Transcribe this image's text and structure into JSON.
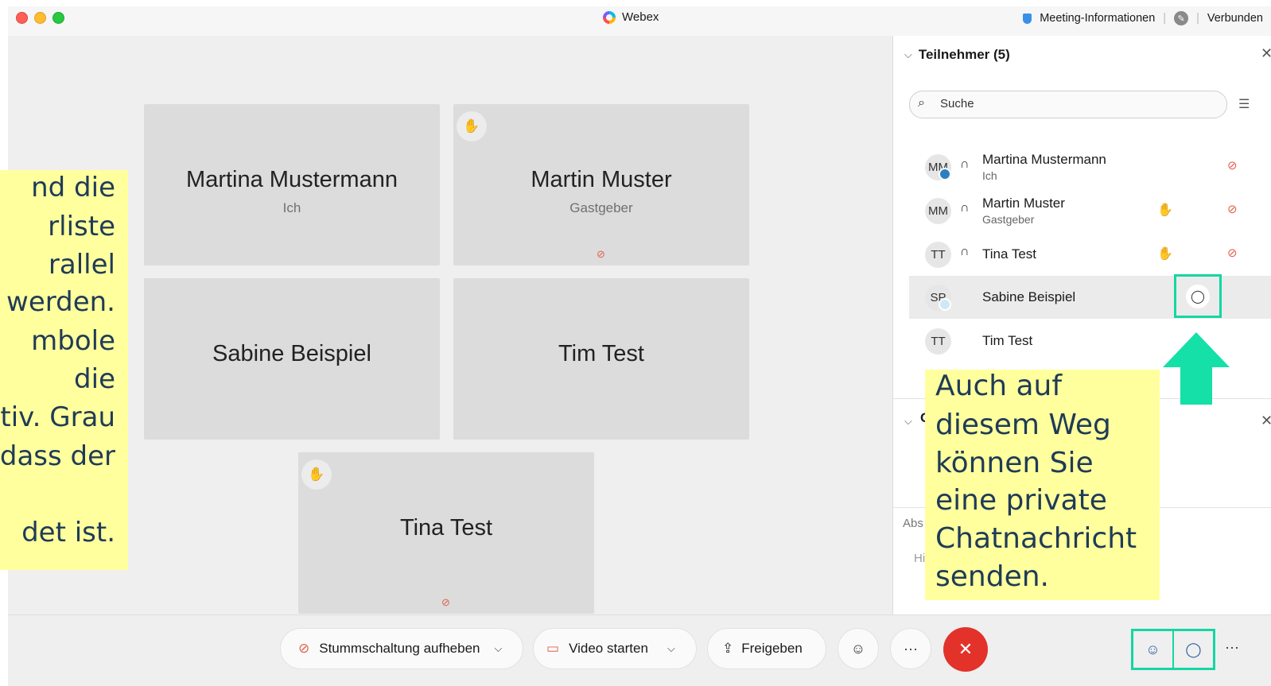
{
  "window": {
    "title": "Webex",
    "meeting_info": "Meeting-Informationen",
    "status": "Verbunden"
  },
  "stage": {
    "tiles": [
      {
        "name": "Martina Mustermann",
        "sub": "Ich"
      },
      {
        "name": "Martin Muster",
        "sub": "Gastgeber"
      },
      {
        "name": "Sabine Beispiel",
        "sub": ""
      },
      {
        "name": "Tim Test",
        "sub": ""
      },
      {
        "name": "Tina Test",
        "sub": ""
      }
    ]
  },
  "participants_panel": {
    "title": "Teilnehmer (5)",
    "search_placeholder": "Suche",
    "items": [
      {
        "initials": "MM",
        "name": "Martina Mustermann",
        "sub": "Ich"
      },
      {
        "initials": "MM",
        "name": "Martin Muster",
        "sub": "Gastgeber"
      },
      {
        "initials": "TT",
        "name": "Tina Test",
        "sub": ""
      },
      {
        "initials": "SP",
        "name": "Sabine Beispiel",
        "sub": ""
      },
      {
        "initials": "TT",
        "name": "Tim Test",
        "sub": ""
      }
    ]
  },
  "chat_panel": {
    "header_partial": "C",
    "to_partial": "Abs",
    "input_partial": "Hi"
  },
  "toolbar": {
    "unmute_label": "Stummschaltung aufheben",
    "video_label": "Video starten",
    "share_label": "Freigeben",
    "more_label": "···",
    "more_right": "···"
  },
  "annotations": {
    "left_lines": [
      "nd die",
      "rliste",
      "rallel",
      "werden.",
      "mbole",
      "die",
      "tiv. Grau",
      "dass der",
      "",
      "det ist."
    ],
    "right_lines": [
      "Auch auf",
      "diesem Weg",
      "können Sie",
      "eine private",
      "Chatnachricht",
      "senden."
    ]
  },
  "colors": {
    "highlight": "#14d6a4",
    "end_call": "#e2322a",
    "note_bg": "#ffff9e",
    "note_text": "#1f3b57",
    "mute": "#e0614d"
  }
}
